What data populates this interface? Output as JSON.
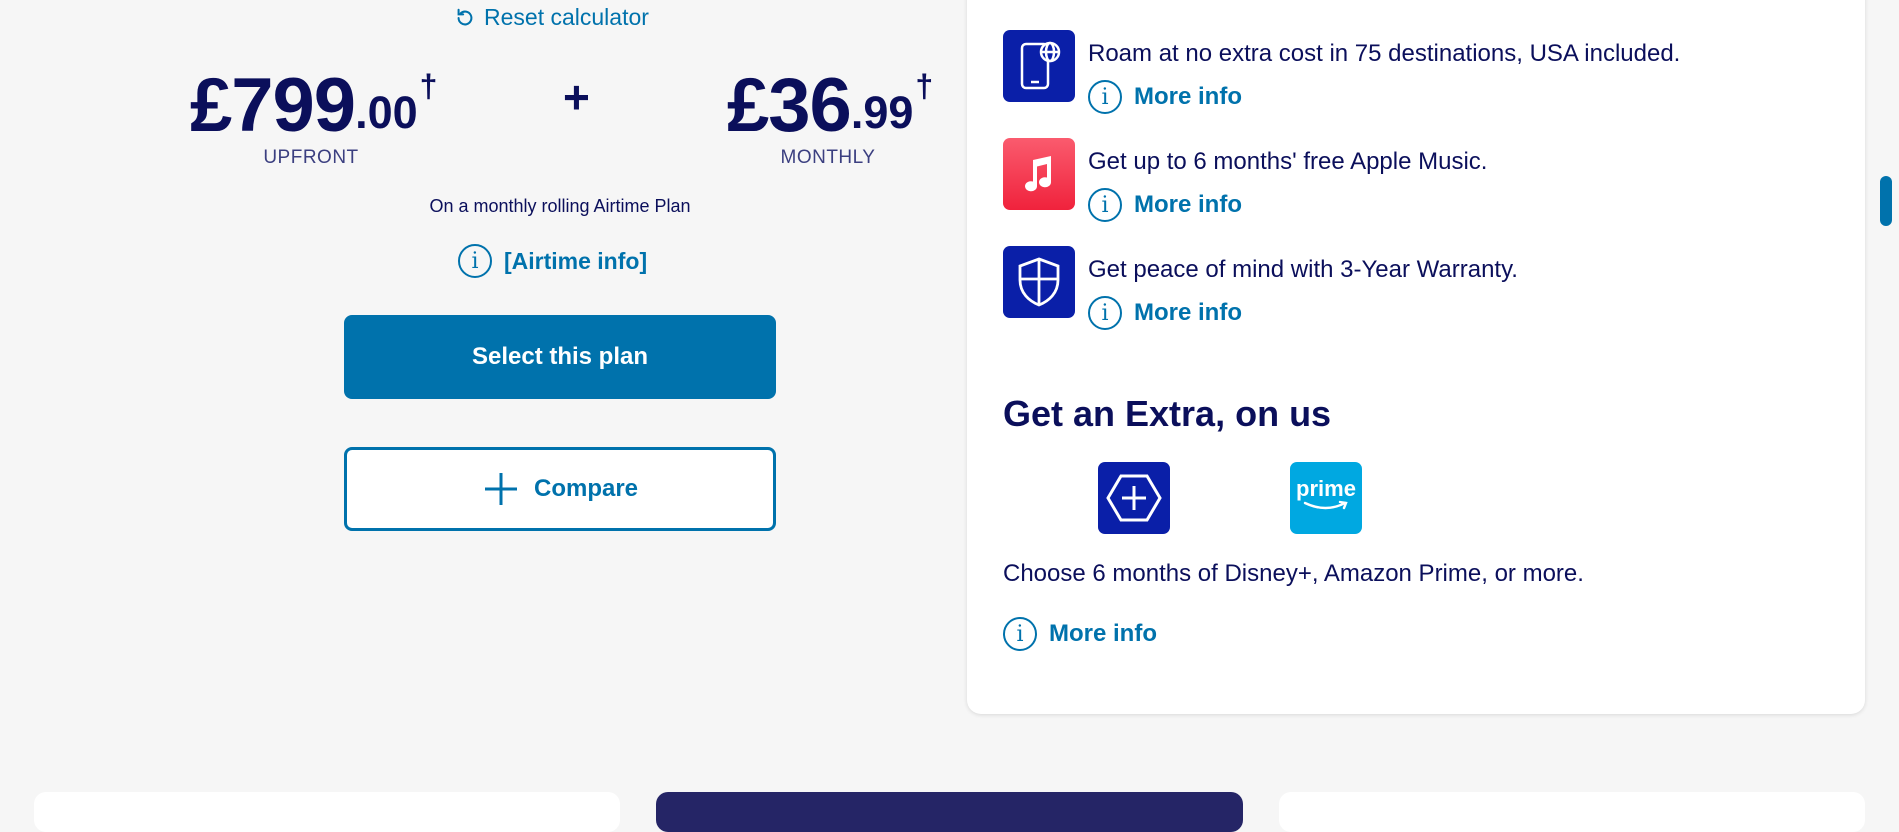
{
  "calculator": {
    "reset_label": "Reset calculator",
    "upfront": {
      "whole": "£799",
      "decimal": ".00",
      "dagger": "†",
      "label": "UPFRONT"
    },
    "plus": "+",
    "monthly": {
      "whole": "£36",
      "decimal": ".99",
      "dagger": "†",
      "label": "MONTHLY"
    },
    "plan_note": "On a monthly rolling Airtime Plan",
    "airtime_info": "[Airtime info]",
    "select_label": "Select this plan",
    "compare_label": "Compare"
  },
  "perks": [
    {
      "icon": "roaming-phone-icon",
      "text": "Roam at no extra cost in 75 destinations, USA included.",
      "more": "More info",
      "color": "#0a1fa8"
    },
    {
      "icon": "apple-music-icon",
      "text": "Get up to 6 months' free Apple Music.",
      "more": "More info",
      "color": "#f0354a"
    },
    {
      "icon": "warranty-shield-icon",
      "text": "Get peace of mind with 3-Year Warranty.",
      "more": "More info",
      "color": "#0a1fa8"
    }
  ],
  "extra": {
    "title": "Get an Extra, on us",
    "tiles": [
      {
        "icon": "extra-plus-icon",
        "color": "#0a1fa8"
      },
      {
        "icon": "prime-icon",
        "label": "prime",
        "color": "#00a8e1"
      }
    ],
    "description": "Choose 6 months of Disney+, Amazon Prime, or more.",
    "more": "More info"
  },
  "colors": {
    "accent": "#0072ac",
    "navy": "#0b0f5b",
    "background": "#f6f6f6",
    "bottom_middle_card": "#252566"
  }
}
